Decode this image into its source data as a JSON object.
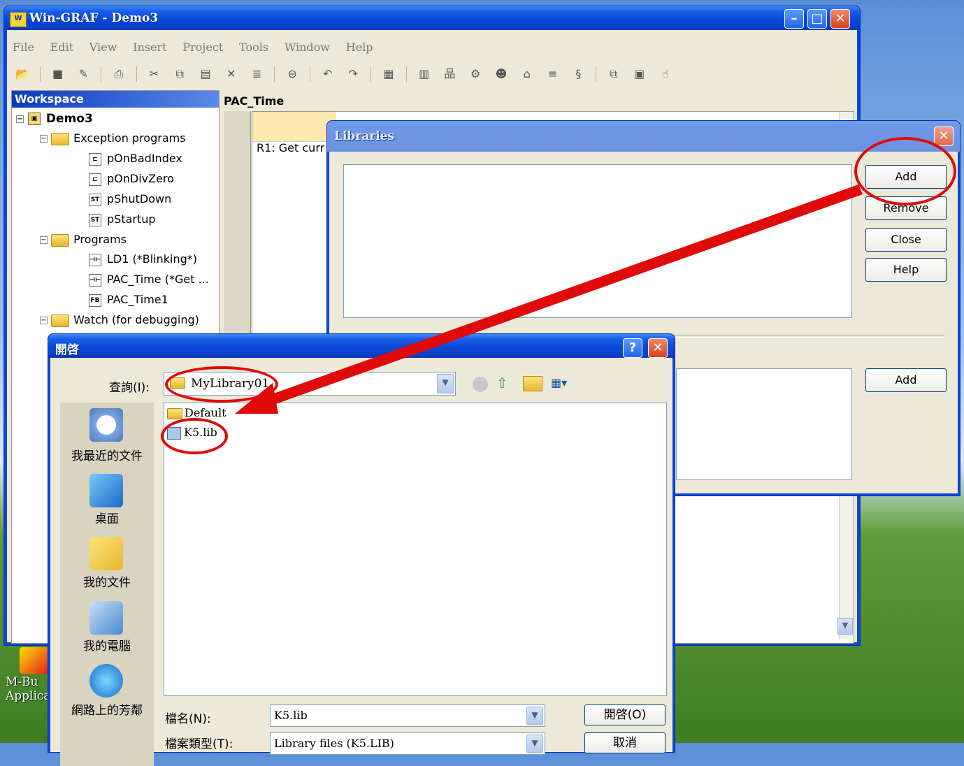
{
  "main_window": {
    "title": "Win-GRAF  - Demo3",
    "menus": [
      "File",
      "Edit",
      "View",
      "Insert",
      "Project",
      "Tools",
      "Window",
      "Help"
    ]
  },
  "workspace": {
    "header": "Workspace",
    "root": "Demo3",
    "items": [
      {
        "label": "Exception programs",
        "kind": "folder"
      },
      {
        "label": "pOnBadIndex",
        "kind": "sfc"
      },
      {
        "label": "pOnDivZero",
        "kind": "sfc"
      },
      {
        "label": "pShutDown",
        "kind": "ST"
      },
      {
        "label": "pStartup",
        "kind": "ST"
      },
      {
        "label": "Programs",
        "kind": "folder"
      },
      {
        "label": "LD1 (*Blinking*)",
        "kind": "LD"
      },
      {
        "label": "PAC_Time (*Get ...",
        "kind": "LD"
      },
      {
        "label": "PAC_Time1",
        "kind": "FB"
      },
      {
        "label": "Watch (for debugging)",
        "kind": "folder"
      }
    ]
  },
  "editor": {
    "title": "PAC_Time",
    "rung_label": "R1: Get curr"
  },
  "libraries_dialog": {
    "title": "Libraries",
    "buttons": {
      "add": "Add",
      "remove": "Remove",
      "close": "Close",
      "help": "Help",
      "add2": "Add"
    }
  },
  "open_dialog": {
    "title": "開啓",
    "lookin_label": "查詢(I):",
    "lookin_value": "MyLibrary01",
    "files": [
      {
        "name": "Default",
        "kind": "folder"
      },
      {
        "name": "K5.lib",
        "kind": "lib"
      }
    ],
    "places": [
      "我最近的文件",
      "桌面",
      "我的文件",
      "我的電腦",
      "網路上的芳鄰"
    ],
    "filename_label": "檔名(N):",
    "filename_value": "K5.lib",
    "filetype_label": "檔案類型(T):",
    "filetype_value": "Library files (K5.LIB)",
    "open_button": "開啓(O)",
    "cancel_button": "取消"
  },
  "desktop": {
    "shortcut_label": "M-Bu\nApplica"
  },
  "colors": {
    "annotation": "#e00a0a",
    "xp_blue": "#0a46d8",
    "dialog_face": "#ece9d8"
  }
}
